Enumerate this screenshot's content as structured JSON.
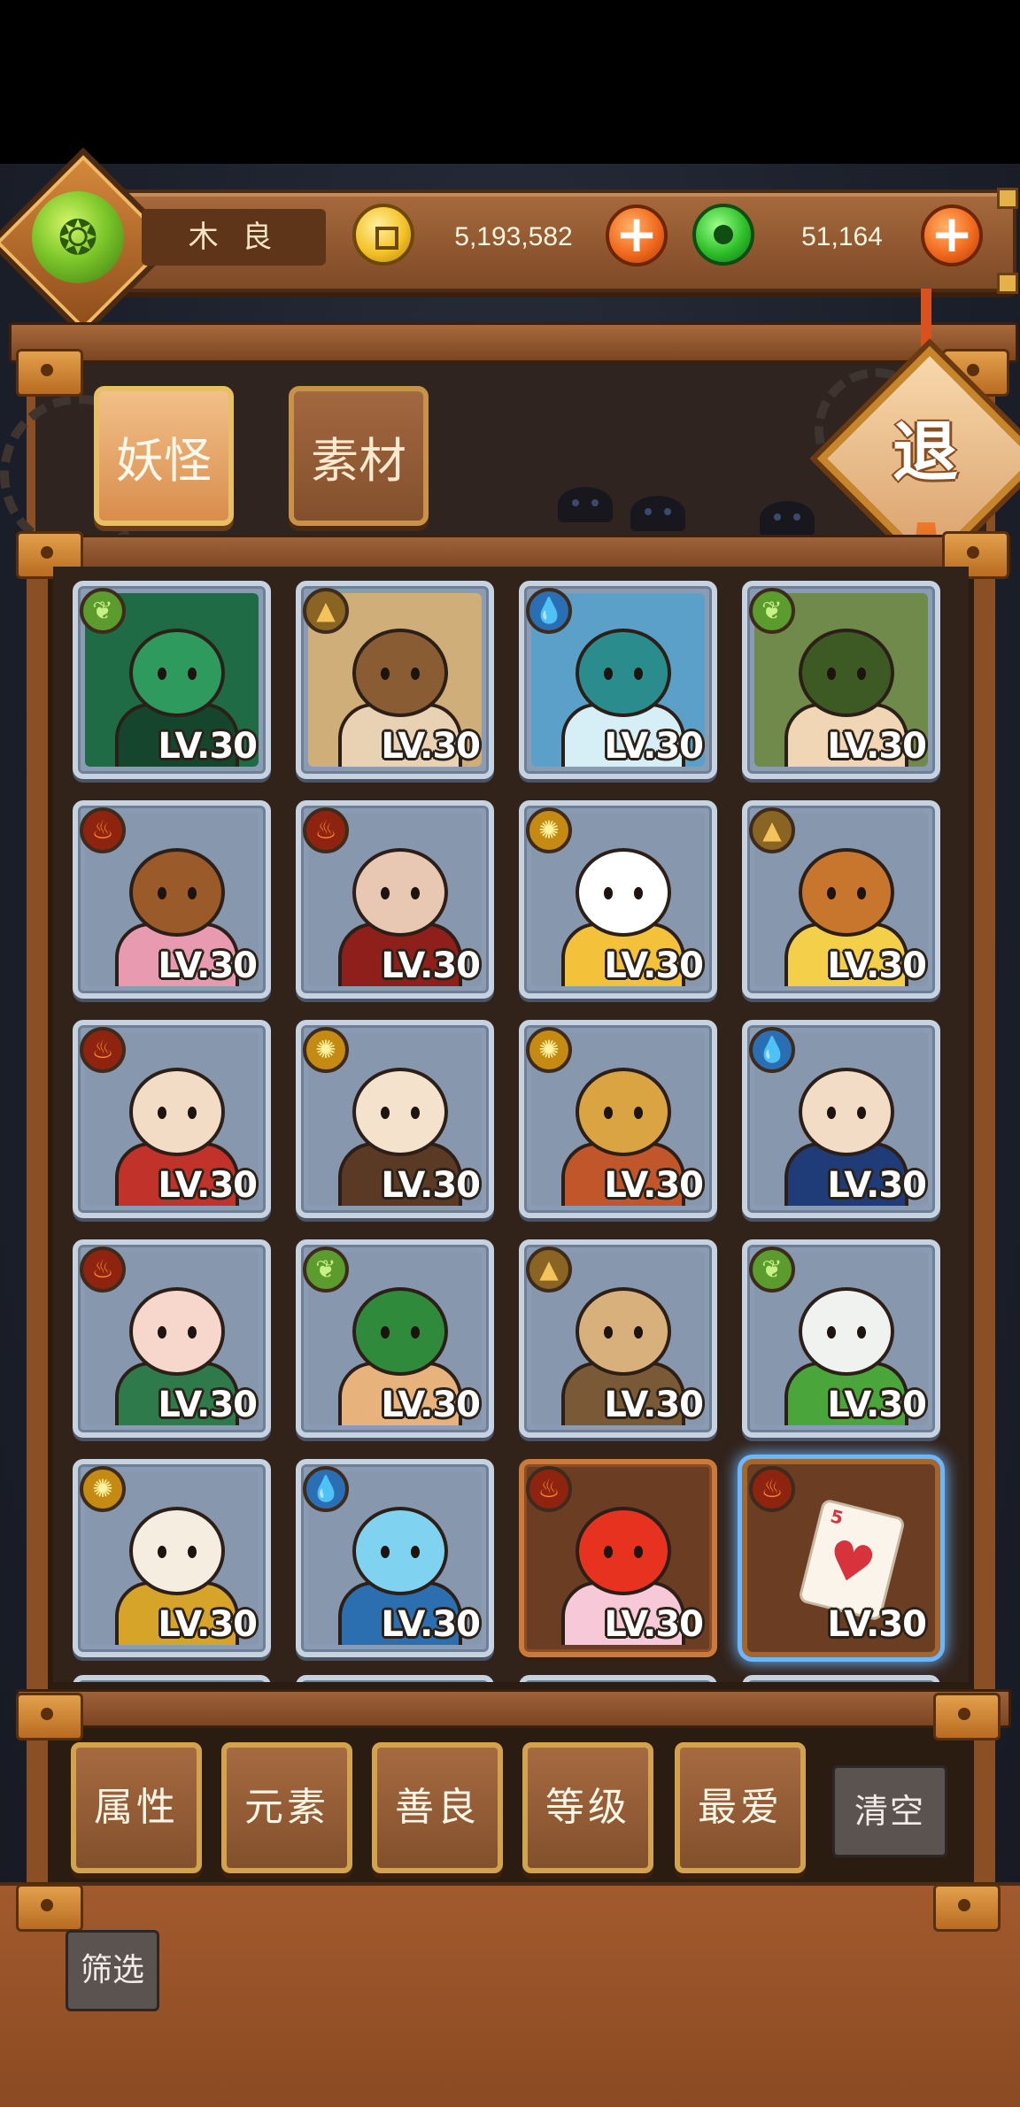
{
  "player": {
    "name": "木 良",
    "avatar_icon": "jade-dragon-avatar-icon"
  },
  "resources": {
    "gold": "5,193,582",
    "jade": "51,164",
    "add_label": "+"
  },
  "tabs": [
    {
      "label": "妖怪",
      "active": true
    },
    {
      "label": "素材",
      "active": false
    }
  ],
  "exit_label": "退",
  "monsters": [
    {
      "level": "LV.30",
      "element": "wood",
      "palette": [
        "#1f6b45",
        "#2f9a5e",
        "#16452d"
      ]
    },
    {
      "level": "LV.30",
      "element": "earth",
      "palette": [
        "#cfae7a",
        "#8a5c34",
        "#e9d2b4"
      ]
    },
    {
      "level": "LV.30",
      "element": "water",
      "palette": [
        "#5aa0c8",
        "#2a8c8c",
        "#d6eef6"
      ]
    },
    {
      "level": "LV.30",
      "element": "wood",
      "palette": [
        "#6f8a4a",
        "#3d5a24",
        "#f0d6b5"
      ]
    },
    {
      "level": "LV.30",
      "element": "fire",
      "palette": [
        "#8797ad",
        "#9a5a2a",
        "#e79ab0"
      ]
    },
    {
      "level": "LV.30",
      "element": "fire",
      "palette": [
        "#8797ad",
        "#e8c8b2",
        "#8e1f1a"
      ]
    },
    {
      "level": "LV.30",
      "element": "gold",
      "palette": [
        "#8797ad",
        "#ffffff",
        "#f3c23a"
      ]
    },
    {
      "level": "LV.30",
      "element": "earth",
      "palette": [
        "#8797ad",
        "#c8762e",
        "#f3cf4a"
      ]
    },
    {
      "level": "LV.30",
      "element": "fire",
      "palette": [
        "#8797ad",
        "#f3dcc6",
        "#c0322a"
      ]
    },
    {
      "level": "LV.30",
      "element": "gold",
      "palette": [
        "#8797ad",
        "#f4e2cc",
        "#5a3a24"
      ]
    },
    {
      "level": "LV.30",
      "element": "gold",
      "palette": [
        "#8797ad",
        "#d9a441",
        "#c1562a"
      ]
    },
    {
      "level": "LV.30",
      "element": "water",
      "palette": [
        "#8797ad",
        "#f3dcc6",
        "#1f3c78"
      ]
    },
    {
      "level": "LV.30",
      "element": "fire",
      "palette": [
        "#8797ad",
        "#f7d6cc",
        "#2f7a4a"
      ]
    },
    {
      "level": "LV.30",
      "element": "wood",
      "palette": [
        "#8797ad",
        "#2f8a3c",
        "#e8b27c"
      ]
    },
    {
      "level": "LV.30",
      "element": "earth",
      "palette": [
        "#8797ad",
        "#d8b07c",
        "#7a5a36"
      ]
    },
    {
      "level": "LV.30",
      "element": "wood",
      "palette": [
        "#8797ad",
        "#f0f2f0",
        "#4aa53a"
      ]
    },
    {
      "level": "LV.30",
      "element": "gold",
      "palette": [
        "#8797ad",
        "#f4ede0",
        "#d7a42a"
      ]
    },
    {
      "level": "LV.30",
      "element": "water",
      "palette": [
        "#8797ad",
        "#7fd2f0",
        "#2c6fb0"
      ]
    },
    {
      "level": "LV.30",
      "element": "fire",
      "palette": [
        "#6b3d22",
        "#e7321f",
        "#f6c8d8"
      ],
      "special": true
    },
    {
      "level": "LV.30",
      "element": "fire",
      "palette": [
        "#6b3d22",
        "#fbf4ea",
        "#d8333d"
      ],
      "special": true,
      "selected": true,
      "card": true
    }
  ],
  "filters": [
    {
      "label": "属性"
    },
    {
      "label": "元素"
    },
    {
      "label": "善良"
    },
    {
      "label": "等级"
    },
    {
      "label": "最爱"
    }
  ],
  "clear_label": "清空",
  "screen_label": "筛选",
  "element_icons": {
    "wood": "leaf-icon",
    "fire": "flame-icon",
    "water": "water-drop-icon",
    "earth": "mountain-icon",
    "gold": "sun-icon"
  }
}
